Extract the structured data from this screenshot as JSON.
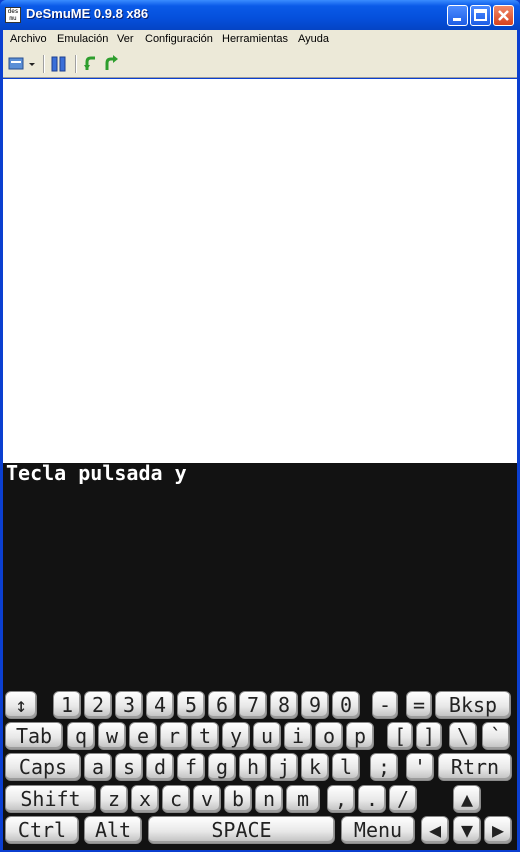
{
  "window": {
    "title": "DeSmuME 0.9.8 x86",
    "app_icon_text": "des mu me"
  },
  "menu": [
    "Archivo",
    "Emulación",
    "Ver",
    "Configuración",
    "Herramientas",
    "Ayuda"
  ],
  "console": {
    "line": "Tecla pulsada y"
  },
  "keyboard": {
    "row1": [
      "↕",
      "1",
      "2",
      "3",
      "4",
      "5",
      "6",
      "7",
      "8",
      "9",
      "0",
      "-",
      "=",
      "Bksp"
    ],
    "row2": [
      "Tab",
      "q",
      "w",
      "e",
      "r",
      "t",
      "y",
      "u",
      "i",
      "o",
      "p",
      "[",
      "]",
      "\\",
      "`"
    ],
    "row3": [
      "Caps",
      "a",
      "s",
      "d",
      "f",
      "g",
      "h",
      "j",
      "k",
      "l",
      ";",
      "'",
      "Rtrn"
    ],
    "row4": [
      "Shift",
      "z",
      "x",
      "c",
      "v",
      "b",
      "n",
      "m",
      ",",
      ".",
      "/",
      "▲"
    ],
    "row5": [
      "Ctrl",
      "Alt",
      "SPACE",
      "Menu",
      "◀",
      "▼",
      "▶"
    ]
  },
  "colors": {
    "titlebar": "#0550dc",
    "menubar": "#ece9d8",
    "top_screen": "#ffffff",
    "bottom_screen": "#121212"
  },
  "icons": [
    "app-icon",
    "open-rom-icon",
    "pause-icon",
    "undo-arrow-icon",
    "redo-arrow-icon",
    "minimize-icon",
    "maximize-icon",
    "close-icon"
  ]
}
